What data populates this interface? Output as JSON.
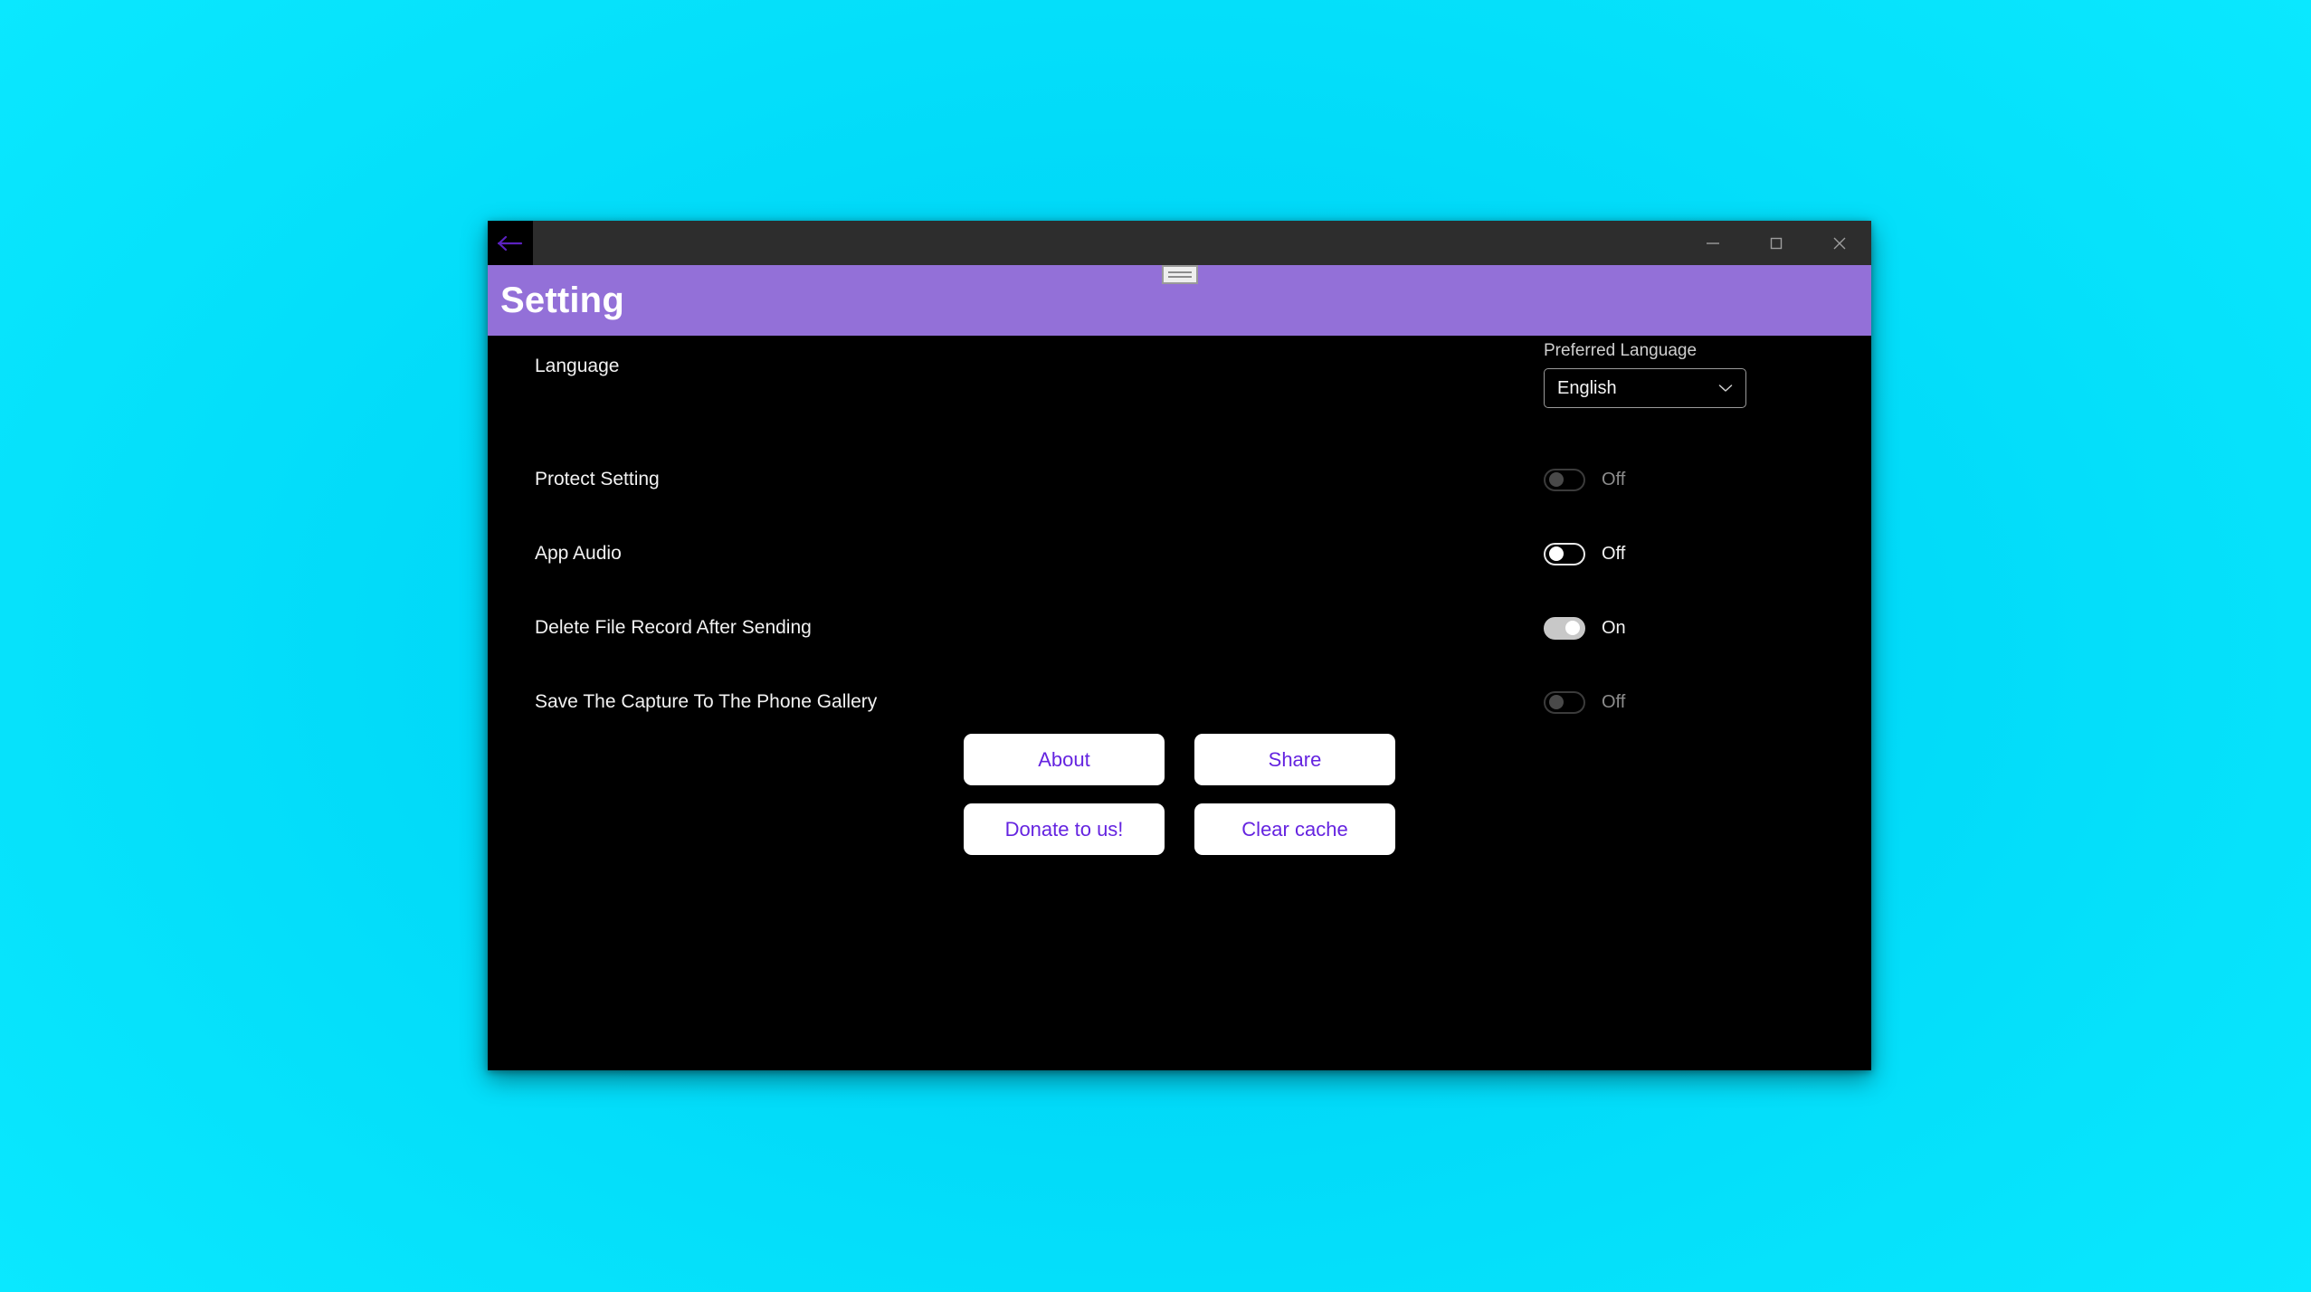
{
  "window": {
    "back_icon": "arrow-left-icon",
    "controls": {
      "minimize": "minimize-icon",
      "maximize": "maximize-icon",
      "close": "close-icon"
    }
  },
  "header": {
    "title": "Setting",
    "handle_icon": "drag-handle-icon"
  },
  "settings": {
    "language_row": {
      "label": "Language",
      "control_label": "Preferred Language",
      "selected": "English",
      "chevron_icon": "chevron-down-icon"
    },
    "toggles": [
      {
        "label": "Protect Setting",
        "state_text": "Off",
        "state": "off",
        "enabled": false
      },
      {
        "label": "App Audio",
        "state_text": "Off",
        "state": "off",
        "enabled": true
      },
      {
        "label": "Delete File Record After Sending",
        "state_text": "On",
        "state": "on",
        "enabled": true
      },
      {
        "label": "Save The Capture To The Phone Gallery",
        "state_text": "Off",
        "state": "off",
        "enabled": false
      }
    ]
  },
  "actions": {
    "rows": [
      {
        "left": "About",
        "right": "Share"
      },
      {
        "left": "Donate to us!",
        "right": "Clear cache"
      }
    ]
  },
  "colors": {
    "desktop": "#00d8f8",
    "header_purple": "#9370d8",
    "accent_purple": "#6524e0",
    "titlebar": "#2d2d2d",
    "content_bg": "#000000",
    "toggle_on_track": "#c8c8c8"
  }
}
